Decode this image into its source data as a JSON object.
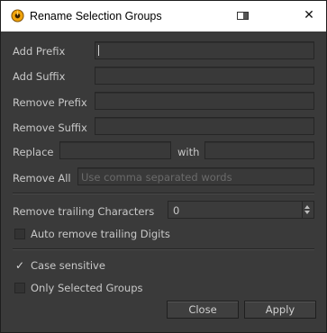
{
  "window": {
    "title": "Rename Selection Groups",
    "close_glyph": "✕",
    "app_icon": "nuke-icon",
    "dock_icon": "float-window-icon"
  },
  "fields": {
    "add_prefix": {
      "label": "Add Prefix",
      "value": ""
    },
    "add_suffix": {
      "label": "Add Suffix",
      "value": ""
    },
    "remove_prefix": {
      "label": "Remove Prefix",
      "value": ""
    },
    "remove_suffix": {
      "label": "Remove Suffix",
      "value": ""
    },
    "replace": {
      "label": "Replace",
      "value": "",
      "with_label": "with",
      "with_value": ""
    },
    "remove_all": {
      "label": "Remove All",
      "placeholder": "Use comma separated words"
    }
  },
  "trailing": {
    "label": "Remove trailing Characters",
    "value": "0",
    "auto_remove_label": "Auto remove trailing Digits",
    "auto_remove_checked": false
  },
  "options": {
    "case_sensitive_label": "Case sensitive",
    "case_sensitive_checked": true,
    "case_sensitive_glyph": "✓",
    "only_selected_label": "Only Selected Groups",
    "only_selected_checked": false
  },
  "buttons": {
    "close": "Close",
    "apply": "Apply"
  }
}
